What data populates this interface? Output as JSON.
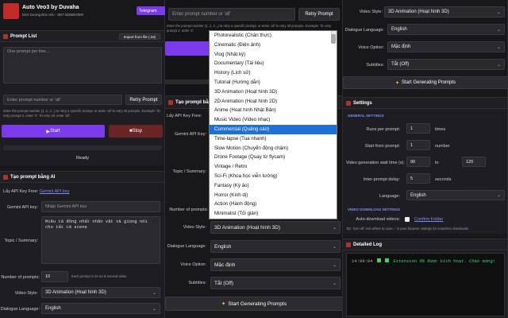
{
  "app": {
    "title": "Auto Veo3 by Duvaha",
    "subtitle": "DSV Dương Đức Hải – SĐT 0336667800",
    "telegram": "Telegram"
  },
  "prompt_list": {
    "title": "Prompt List",
    "import_label": "Import from file (.txt)",
    "placeholder": "One prompt per line...",
    "retry_placeholder": "Enter prompt number or 'all'",
    "retry_label": "Retry Prompt",
    "retry_note": "Enter the prompt number (1, 2, 3...) to retry a specific prompt, or enter 'all' to retry all prompts. Example: To retry prompt 2, enter '2'. To retry all, enter 'all'.",
    "start_label": "Start",
    "stop_label": "Stop",
    "status": "Ready"
  },
  "ai_gen": {
    "title": "Tạo prompt bằng AI",
    "key_text": "Lấy API Key Free:",
    "key_link": "Gemini API key",
    "gemini_label": "Gemini API key:",
    "gemini_placeholder": "Nhập Gemini API key",
    "topic_label": "Topic / Summary:",
    "topic_value": "Miêu tả đồng nhất nhân vật và giọng nói cho tất cả scene",
    "num_label": "Number of prompts:",
    "num_value": "10",
    "num_note": "Each prompt is for an 8-second video",
    "style_label": "Video Style:",
    "style_value": "3D Animation (Hoạt hình 3D)",
    "lang_label": "Dialogue Language:",
    "lang_value": "English"
  },
  "middle": {
    "retry_placeholder": "Enter prompt number or 'all'",
    "retry_label": "Retry Prompt",
    "retry_note": "Enter the prompt number (1, 2, 3...) to retry a specific prompt, or enter 'all' to retry all prompts. Example: To retry prompt 2, enter '2'.",
    "section_title": "Tạo prompt bằng AI",
    "key_text": "Lấy API Key Free:",
    "gemini_label": "Gemini API Key:",
    "topic_label": "Topic / Summary:",
    "num_label": "Number of prompts:",
    "style_label": "Video Style:",
    "style_value": "3D Animation (Hoạt hình 3D)",
    "lang_label": "Dialogue Language:",
    "lang_value": "English",
    "voice_label": "Voice Option:",
    "voice_value": "Mặc định",
    "subtitle_label": "Subtitles:",
    "subtitle_value": "Tắt (Off)",
    "generate_label": "Start Generating Prompts"
  },
  "dropdown": [
    "Photorealistic (Chân thực)",
    "Cinematic (Điện ảnh)",
    "Vlog (Nhật ký)",
    "Documentary (Tài liệu)",
    "History (Lịch sử)",
    "Tutorial (Hướng dẫn)",
    "3D Animation (Hoạt hình 3D)",
    "2D Animation (Hoạt hình 2D)",
    "Anime (Hoạt hình Nhật Bản)",
    "Music Video (Video nhạc)",
    "Commercial (Quảng cáo)",
    "Time-lapse (Tua nhanh)",
    "Slow Motion (Chuyển động chậm)",
    "Drone Footage (Quay từ flycam)",
    "Vintage / Retro",
    "Sci-Fi (Khoa học viễn tưởng)",
    "Fantasy (Kỳ ảo)",
    "Horror (Kinh dị)",
    "Action (Hành động)",
    "Minimalist (Tối giản)"
  ],
  "dropdown_selected": 10,
  "right": {
    "style_label": "Video Style:",
    "style_value": "3D Animation (Hoạt hình 3D)",
    "lang_label": "Dialogue Language:",
    "lang_value": "English",
    "voice_label": "Voice Option:",
    "voice_value": "Mặc định",
    "subtitle_label": "Subtitles:",
    "subtitle_value": "Tắt (Off)",
    "generate_label": "Start Generating Prompts",
    "settings_title": "Settings",
    "general": "GENERAL SETTINGS",
    "runs_label": "Runs per prompt:",
    "runs_value": "1",
    "runs_unit": "times",
    "start_label": "Start from prompt:",
    "start_value": "1",
    "start_unit": "number",
    "wait_label": "Video generation wait time (s):",
    "wait_from": "90",
    "wait_to_label": "to",
    "wait_to": "120",
    "delay_label": "Inter-prompt delay:",
    "delay_value": "5",
    "delay_unit": "seconds",
    "language_label": "Language:",
    "language_value": "English",
    "download_title": "VIDEO DOWNLOAD SETTINGS",
    "auto_label": "Auto-download videos:",
    "confirm_label": "Confirm Folder",
    "tip": "Tip: Turn off 'Ask where to save...' in your browser settings for seamless downloads.",
    "log_title": "Detailed Log",
    "log_time": "14:09:04",
    "log_msg": "Extension đã được kích hoạt. Chào mừng!"
  }
}
